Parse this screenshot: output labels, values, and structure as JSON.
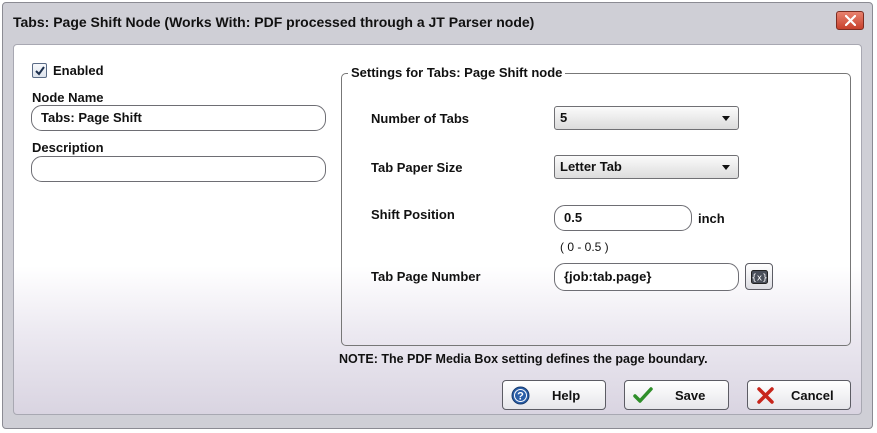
{
  "window": {
    "title": "Tabs: Page Shift Node (Works With: PDF processed through a JT Parser node)"
  },
  "left": {
    "enabled_label": "Enabled",
    "enabled_checked": true,
    "node_name_label": "Node Name",
    "node_name_value": "Tabs: Page Shift",
    "description_label": "Description",
    "description_value": ""
  },
  "settings": {
    "legend": "Settings for Tabs: Page Shift node",
    "num_tabs_label": "Number of Tabs",
    "num_tabs_value": "5",
    "paper_size_label": "Tab Paper Size",
    "paper_size_value": "Letter Tab",
    "shift_position_label": "Shift Position",
    "shift_position_value": "0.5",
    "shift_unit": "inch",
    "shift_range": "( 0 - 0.5 )",
    "tab_page_label": "Tab Page Number",
    "tab_page_value": "{job:tab.page}"
  },
  "note": "NOTE: The PDF Media Box setting defines the page boundary.",
  "buttons": {
    "help": "Help",
    "save": "Save",
    "cancel": "Cancel"
  },
  "icons": {
    "close": "close-icon",
    "check": "checkmark-icon",
    "help": "help-icon",
    "save": "checkmark-icon",
    "cancel": "x-icon",
    "variable": "variable-icon"
  },
  "colors": {
    "close_button": "#d0533d",
    "save_check": "#2f8f2a",
    "cancel_x": "#c8261c",
    "help_blue": "#2b5fa8"
  }
}
